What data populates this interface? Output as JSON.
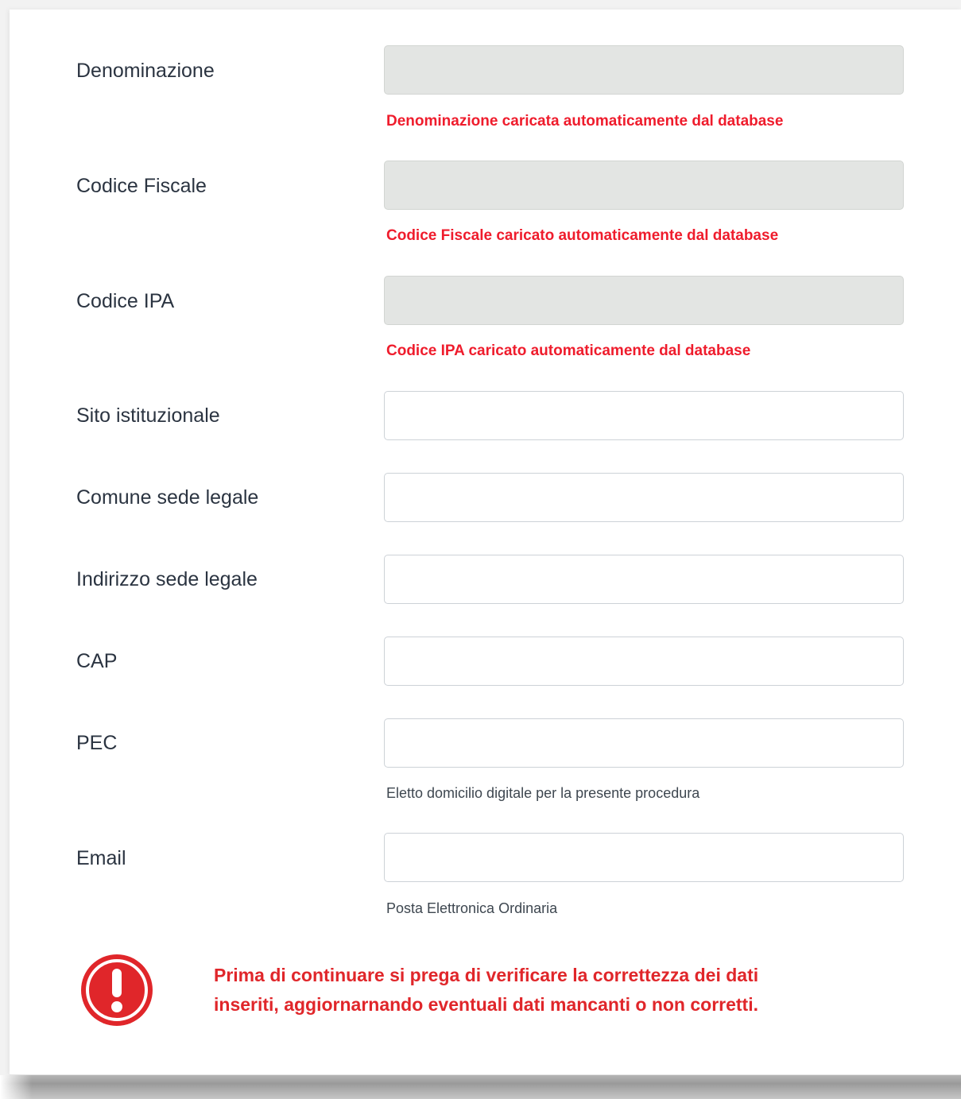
{
  "form": {
    "fields": [
      {
        "label": "Denominazione",
        "value": "",
        "readonly": true,
        "hint": "Denominazione caricata automaticamente dal database",
        "hint_style": "error"
      },
      {
        "label": "Codice Fiscale",
        "value": "",
        "readonly": true,
        "hint": "Codice Fiscale caricato automaticamente dal database",
        "hint_style": "error"
      },
      {
        "label": "Codice IPA",
        "value": "",
        "readonly": true,
        "hint": "Codice IPA caricato automaticamente dal database",
        "hint_style": "error"
      },
      {
        "label": "Sito istituzionale",
        "value": "",
        "readonly": false
      },
      {
        "label": "Comune sede legale",
        "value": "",
        "readonly": false
      },
      {
        "label": "Indirizzo sede legale",
        "value": "",
        "readonly": false
      },
      {
        "label": "CAP",
        "value": "",
        "readonly": false
      },
      {
        "label": "PEC",
        "value": "",
        "readonly": false,
        "hint": "Eletto domicilio digitale per la presente procedura",
        "hint_style": "muted"
      },
      {
        "label": "Email",
        "value": "",
        "readonly": false,
        "hint": "Posta Elettronica Ordinaria",
        "hint_style": "muted"
      }
    ]
  },
  "warning": {
    "icon": "exclamation-circle-icon",
    "text": "Prima di continuare si prega di verificare la correttezza dei dati inseriti, aggiornarnando eventuali dati mancanti o non corretti."
  },
  "colors": {
    "error_text": "#ef1c2c",
    "warning_red": "#e0262a",
    "readonly_bg": "#e3e5e3",
    "label_text": "#2b3441"
  }
}
